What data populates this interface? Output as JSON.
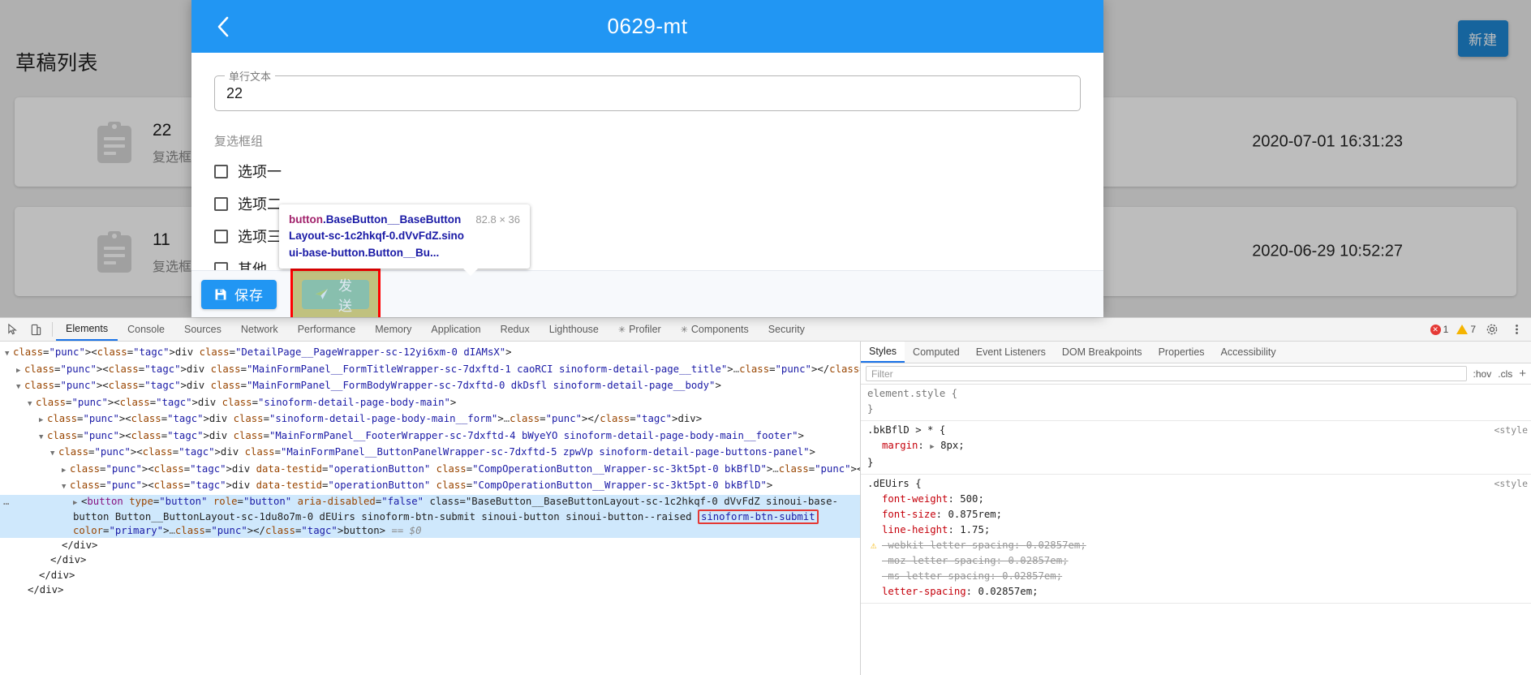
{
  "page": {
    "title": "草稿列表",
    "new_button": "新建",
    "cards": [
      {
        "number": "22",
        "subtitle": "复选框组:",
        "date": "2020-07-01 16:31:23",
        "icon": "clipboard-icon"
      },
      {
        "number": "11",
        "subtitle": "复选框组:",
        "date": "2020-06-29 10:52:27",
        "icon": "clipboard-icon"
      }
    ]
  },
  "modal": {
    "title": "0629-mt",
    "back_icon": "back-chevron-icon",
    "field": {
      "legend": "单行文本",
      "value": "22"
    },
    "checkbox_group": {
      "label": "复选框组",
      "options": [
        {
          "label": "选项一",
          "checked": false
        },
        {
          "label": "选项二",
          "checked": false
        },
        {
          "label": "选项三",
          "checked": false
        },
        {
          "label": "其他",
          "checked": false
        }
      ]
    },
    "footer": {
      "save_label": "保存",
      "save_icon": "save-disk-icon",
      "send_label": "发送",
      "send_icon": "send-paper-plane-icon"
    }
  },
  "inspector_tooltip": {
    "tag": "button",
    "selector": ".BaseButton__BaseButtonLayout-sc-1c2hkqf-0.dVvFdZ.sinoui-base-button.Button__Bu...",
    "selector_line1": ".BaseButton__BaseButtonLay",
    "selector_line2": "out-sc-1c2hkqf-0.dVvFdZ.sinoui-bas",
    "selector_line3": "e-button.Button__Bu...",
    "dimensions": "82.8 × 36"
  },
  "devtools": {
    "toolbar": {
      "inspect_icon": "inspect-cursor-icon",
      "device_icon": "device-toolbar-icon",
      "tabs": [
        {
          "label": "Elements",
          "active": true
        },
        {
          "label": "Console",
          "active": false
        },
        {
          "label": "Sources",
          "active": false
        },
        {
          "label": "Network",
          "active": false
        },
        {
          "label": "Performance",
          "active": false
        },
        {
          "label": "Memory",
          "active": false
        },
        {
          "label": "Application",
          "active": false
        },
        {
          "label": "Redux",
          "active": false
        },
        {
          "label": "Lighthouse",
          "active": false
        },
        {
          "label": "Profiler",
          "active": false,
          "badge": "react-dot"
        },
        {
          "label": "Components",
          "active": false,
          "badge": "react-dot"
        },
        {
          "label": "Security",
          "active": false
        }
      ],
      "error_count": "1",
      "warning_count": "7",
      "settings_icon": "gear-icon",
      "more_icon": "kebab-menu-icon"
    },
    "dom": [
      {
        "indent": 0,
        "tri": "▼",
        "html": "<div class=\"DetailPage__PageWrapper-sc-12yi6xm-0 dIAMsX\">"
      },
      {
        "indent": 1,
        "tri": "▶",
        "html": "<div class=\"MainFormPanel__FormTitleWrapper-sc-7dxftd-1 caoRCI sinoform-detail-page__title\">…</div>"
      },
      {
        "indent": 1,
        "tri": "▼",
        "html": "<div class=\"MainFormPanel__FormBodyWrapper-sc-7dxftd-0 dkDsfl sinoform-detail-page__body\">"
      },
      {
        "indent": 2,
        "tri": "▼",
        "html": "<div class=\"sinoform-detail-page-body-main\">"
      },
      {
        "indent": 3,
        "tri": "▶",
        "html": "<div class=\"sinoform-detail-page-body-main__form\">…</div>"
      },
      {
        "indent": 3,
        "tri": "▼",
        "html": "<div class=\"MainFormPanel__FooterWrapper-sc-7dxftd-4 bWyeYO sinoform-detail-page-body-main__footer\">"
      },
      {
        "indent": 4,
        "tri": "▼",
        "html": "<div class=\"MainFormPanel__ButtonPanelWrapper-sc-7dxftd-5 zpwVp sinoform-detail-page-buttons-panel\">"
      },
      {
        "indent": 5,
        "tri": "▶",
        "html": "<div data-testid=\"operationButton\" class=\"CompOperationButton__Wrapper-sc-3kt5pt-0 bkBflD\">…</div>"
      },
      {
        "indent": 5,
        "tri": "▼",
        "html": "<div data-testid=\"operationButton\" class=\"CompOperationButton__Wrapper-sc-3kt5pt-0 bkBflD\">"
      }
    ],
    "selected_node": {
      "tag": "button",
      "attrs": "type=\"button\" role=\"button\" aria-disabled=\"false\"",
      "class_line1": "class=\"BaseButton__BaseButtonLayout-sc-1c2hkqf-0 dVvFdZ sinoui-base-",
      "class_line2": "button Button__ButtonLayout-sc-1du8o7m-0 dEUirs sinoform-btn-submit sinoui-button sinoui-button--raised ",
      "highlight": "sinoform-btn-submit",
      "class_line3": " color=\"primary\">…</button> == $0"
    },
    "dom_closers": [
      "</div>",
      "</div>",
      "</div>",
      "</div>"
    ],
    "styles": {
      "tabs": [
        {
          "label": "Styles",
          "active": true
        },
        {
          "label": "Computed",
          "active": false
        },
        {
          "label": "Event Listeners",
          "active": false
        },
        {
          "label": "DOM Breakpoints",
          "active": false
        },
        {
          "label": "Properties",
          "active": false
        },
        {
          "label": "Accessibility",
          "active": false
        }
      ],
      "filter_placeholder": "Filter",
      "hov_label": ":hov",
      "cls_label": ".cls",
      "plus_label": "+",
      "rules": [
        {
          "selector": "element.style {",
          "origin": "",
          "props": [],
          "close": "}"
        },
        {
          "selector": ".bkBflD > * {",
          "origin": "<style",
          "props": [
            {
              "name": "margin",
              "value": "8px;",
              "expandable": true,
              "struck": false,
              "warn": false
            }
          ],
          "close": "}"
        },
        {
          "selector": ".dEUirs {",
          "origin": "<style",
          "props": [
            {
              "name": "font-weight",
              "value": "500;",
              "expandable": false,
              "struck": false,
              "warn": false
            },
            {
              "name": "font-size",
              "value": "0.875rem;",
              "expandable": false,
              "struck": false,
              "warn": false
            },
            {
              "name": "line-height",
              "value": "1.75;",
              "expandable": false,
              "struck": false,
              "warn": false
            },
            {
              "name": "-webkit-letter-spacing",
              "value": "0.02857em;",
              "expandable": false,
              "struck": true,
              "warn": true
            },
            {
              "name": "-moz-letter-spacing",
              "value": "0.02857em;",
              "expandable": false,
              "struck": true,
              "warn": false
            },
            {
              "name": "-ms-letter-spacing",
              "value": "0.02857em;",
              "expandable": false,
              "struck": true,
              "warn": false
            },
            {
              "name": "letter-spacing",
              "value": "0.02857em;",
              "expandable": false,
              "struck": false,
              "warn": false
            }
          ],
          "close": ""
        }
      ]
    }
  },
  "colors": {
    "accent": "#2196f3",
    "new_button": "#1e88d4",
    "highlight_red": "#ff0000",
    "overlay_orange": "#f6b26b",
    "overlay_green": "#93c47d",
    "devtools_link": "#1a1aa6",
    "devtools_tag": "#881280",
    "selected_row": "#cfe8fc"
  }
}
